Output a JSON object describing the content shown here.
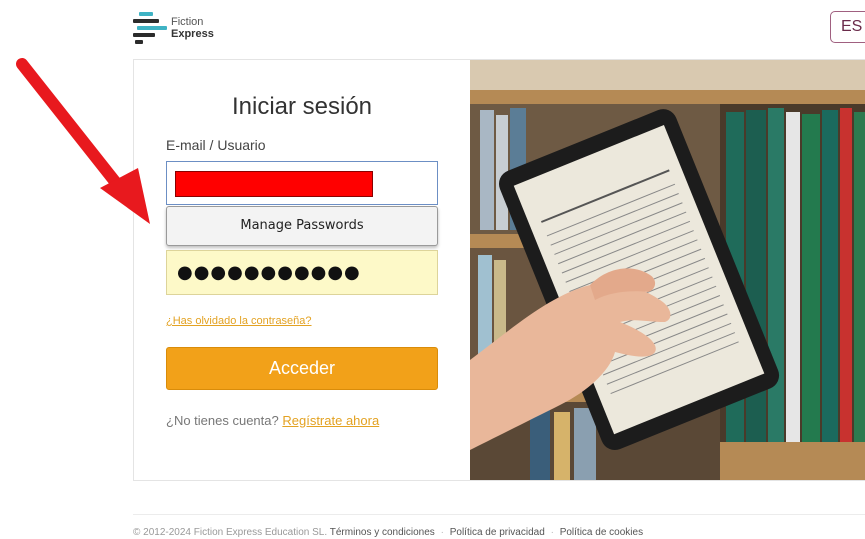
{
  "header": {
    "logo_line1": "Fiction",
    "logo_line2": "Express",
    "language": "ES"
  },
  "login": {
    "title": "Iniciar sesión",
    "email_label": "E-mail / Usuario",
    "autofill_option": "Manage Passwords",
    "password_mask": "●●●●●●●●●●●",
    "forgot_link": "¿Has olvidado la contraseña?",
    "submit_label": "Acceder",
    "no_account_text": "¿No tienes cuenta?",
    "signup_link": "Regístrate ahora"
  },
  "footer": {
    "copyright": "© 2012-2024 Fiction Express Education SL.",
    "terms": "Términos y condiciones",
    "privacy": "Política de privacidad",
    "cookies": "Política de cookies"
  },
  "colors": {
    "accent_orange": "#f2a119",
    "annotation_red": "#e8191e",
    "logo_teal": "#3fb3c4"
  }
}
